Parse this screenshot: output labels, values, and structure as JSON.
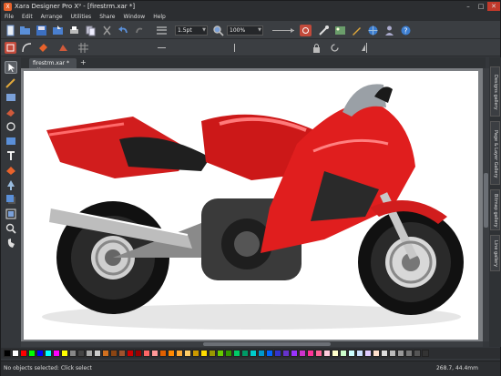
{
  "window": {
    "title": "Xara Designer Pro X⁹ - [firestrm.xar *]",
    "controls": [
      "–",
      "□",
      "✕"
    ]
  },
  "menu": [
    "File",
    "Edit",
    "Arrange",
    "Utilities",
    "Share",
    "Window",
    "Help"
  ],
  "toolbar": {
    "line_width": "1.5pt",
    "zoom": "100%"
  },
  "tab": {
    "label": "firestrm.xar *",
    "close": "✕",
    "add": "+"
  },
  "right_panel": [
    "Designs gallery",
    "Page & Layer Gallery",
    "Bitmap gallery",
    "Line gallery"
  ],
  "status": {
    "message": "No objects selected: Click select",
    "coords": "268.7, 44.4mm"
  },
  "colors": {
    "accent": "#e8622b",
    "palette": [
      "#000000",
      "#ffffff",
      "#ff0000",
      "#00ff00",
      "#0000ff",
      "#00ffff",
      "#ff00ff",
      "#ffff00",
      "#888888",
      "#444444",
      "#aaaaaa",
      "#cccccc",
      "#d07020",
      "#8b4513",
      "#a0522d",
      "#cc0000",
      "#990000",
      "#ff6666",
      "#ff9999",
      "#e06000",
      "#ff8800",
      "#ffaa33",
      "#ffcc66",
      "#cc9900",
      "#ffdd00",
      "#999900",
      "#66cc00",
      "#339900",
      "#00cc66",
      "#009966",
      "#00cccc",
      "#0099cc",
      "#0066ff",
      "#3333cc",
      "#6633cc",
      "#9933ff",
      "#cc33cc",
      "#ff3399",
      "#ff6699",
      "#ffccdd",
      "#ffffcc",
      "#ccffcc",
      "#ccffff",
      "#cce0ff",
      "#e0ccff",
      "#ffe0cc",
      "#dddddd",
      "#bbbbbb",
      "#999999",
      "#777777",
      "#555555",
      "#333333"
    ]
  }
}
